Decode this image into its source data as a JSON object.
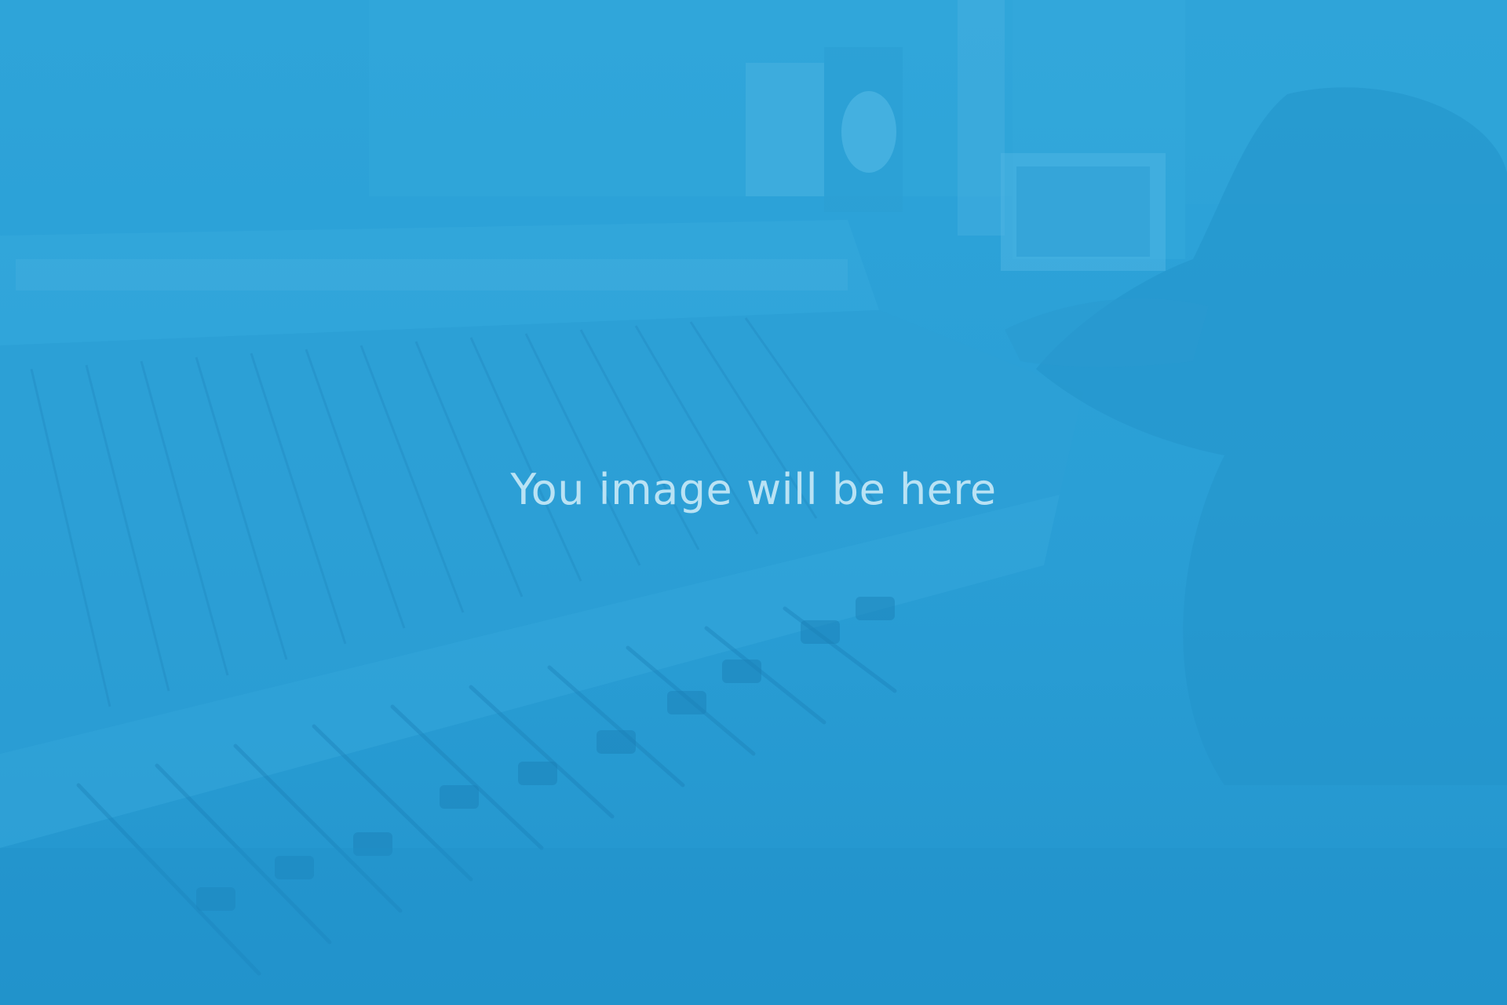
{
  "placeholder": {
    "caption": "You image will be here",
    "background_color": "#2aa0d6",
    "caption_color": "#b9e2f4",
    "scene": "faded-mixing-console-photo"
  }
}
